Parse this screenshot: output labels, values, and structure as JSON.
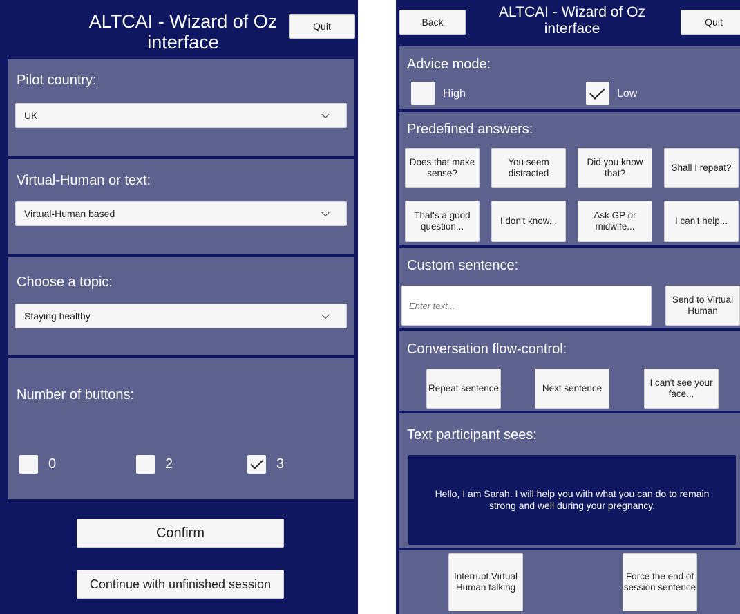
{
  "left": {
    "title": "ALTCAI - Wizard of Oz interface",
    "quit_label": "Quit",
    "pilot_country": {
      "label": "Pilot country:",
      "value": "UK"
    },
    "mode": {
      "label": "Virtual-Human or text:",
      "value": "Virtual-Human based"
    },
    "topic": {
      "label": "Choose a topic:",
      "value": "Staying healthy"
    },
    "buttons": {
      "label": "Number of buttons:",
      "options": [
        {
          "label": "0",
          "checked": false
        },
        {
          "label": "2",
          "checked": false
        },
        {
          "label": "3",
          "checked": true
        }
      ]
    },
    "confirm_label": "Confirm",
    "continue_label": "Continue with unfinished session"
  },
  "right": {
    "back_label": "Back",
    "title": "ALTCAI - Wizard of Oz interface",
    "quit_label": "Quit",
    "advice": {
      "label": "Advice mode:",
      "options": [
        {
          "label": "High",
          "checked": false
        },
        {
          "label": "Low",
          "checked": true
        }
      ]
    },
    "predefined": {
      "label": "Predefined answers:",
      "buttons": [
        "Does that make sense?",
        "You seem distracted",
        "Did you know that?",
        "Shall I repeat?",
        "That's a good question...",
        "I don't know...",
        "Ask GP or midwife...",
        "I can't help..."
      ]
    },
    "custom": {
      "label": "Custom sentence:",
      "placeholder": "Enter text...",
      "send_label": "Send to Virtual Human"
    },
    "flow": {
      "label": "Conversation flow-control:",
      "buttons": [
        "Repeat sentence",
        "Next sentence",
        "I can't see your face..."
      ]
    },
    "participant": {
      "label": "Text participant sees:",
      "text": "Hello, I am Sarah. I will help you with what you can do to remain strong and well during your pregnancy."
    },
    "interrupt_label": "Interrupt Virtual Human talking",
    "force_end_label": "Force the end of session sentence"
  }
}
